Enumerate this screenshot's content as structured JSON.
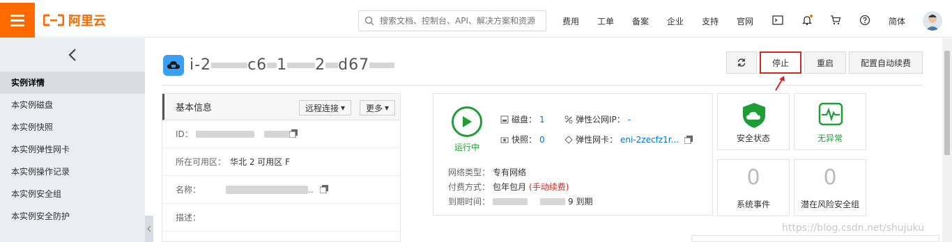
{
  "topbar": {
    "brand": "阿里云",
    "search_placeholder": "搜索文档、控制台、API、解决方案和资源",
    "nav": [
      "费用",
      "工单",
      "备案",
      "企业",
      "支持",
      "官网"
    ],
    "lang": "简体",
    "accent": "#ff6a00"
  },
  "sidebar": {
    "items": [
      {
        "label": "实例详情",
        "active": true
      },
      {
        "label": "本实例磁盘"
      },
      {
        "label": "本实例快照"
      },
      {
        "label": "本实例弹性网卡"
      },
      {
        "label": "本实例操作记录"
      },
      {
        "label": "本实例安全组"
      },
      {
        "label": "本实例安全防护"
      }
    ]
  },
  "header": {
    "title_fragments": [
      "i-2",
      "c6",
      "1",
      "2",
      "d6",
      "7"
    ],
    "actions": {
      "stop": "停止",
      "restart": "重启",
      "auto_renew": "配置自动续费"
    }
  },
  "basic_info": {
    "title": "基本信息",
    "remote_btn": "远程连接",
    "more_btn": "更多",
    "id_label": "ID：",
    "zone_label": "所在可用区：",
    "zone_value": "华北 2 可用区 F",
    "name_label": "名称：",
    "desc_label": "描述："
  },
  "status": {
    "running": "运行中",
    "disk_label": "磁盘：",
    "disk_value": "1",
    "snapshot_label": "快照：",
    "snapshot_value": "0",
    "eip_label": "弹性公网IP：",
    "eip_value": "-",
    "eni_label": "弹性网卡：",
    "eni_value": "eni-2zecfz1r...",
    "net_type_label": "网络类型：",
    "net_type_value": "专有网络",
    "pay_label": "付费方式：",
    "pay_value": "包年包月",
    "pay_note": "(手动续费)",
    "expire_label": "到期时间：",
    "expire_suffix": "9 到期"
  },
  "tiles": {
    "security": "安全状态",
    "no_anomaly": "无异常",
    "sys_events": "系统事件",
    "sys_events_count": "0",
    "risk_groups": "潜在风险安全组",
    "risk_groups_count": "0"
  },
  "watermark": "https://blog.csdn.net/shujuku"
}
